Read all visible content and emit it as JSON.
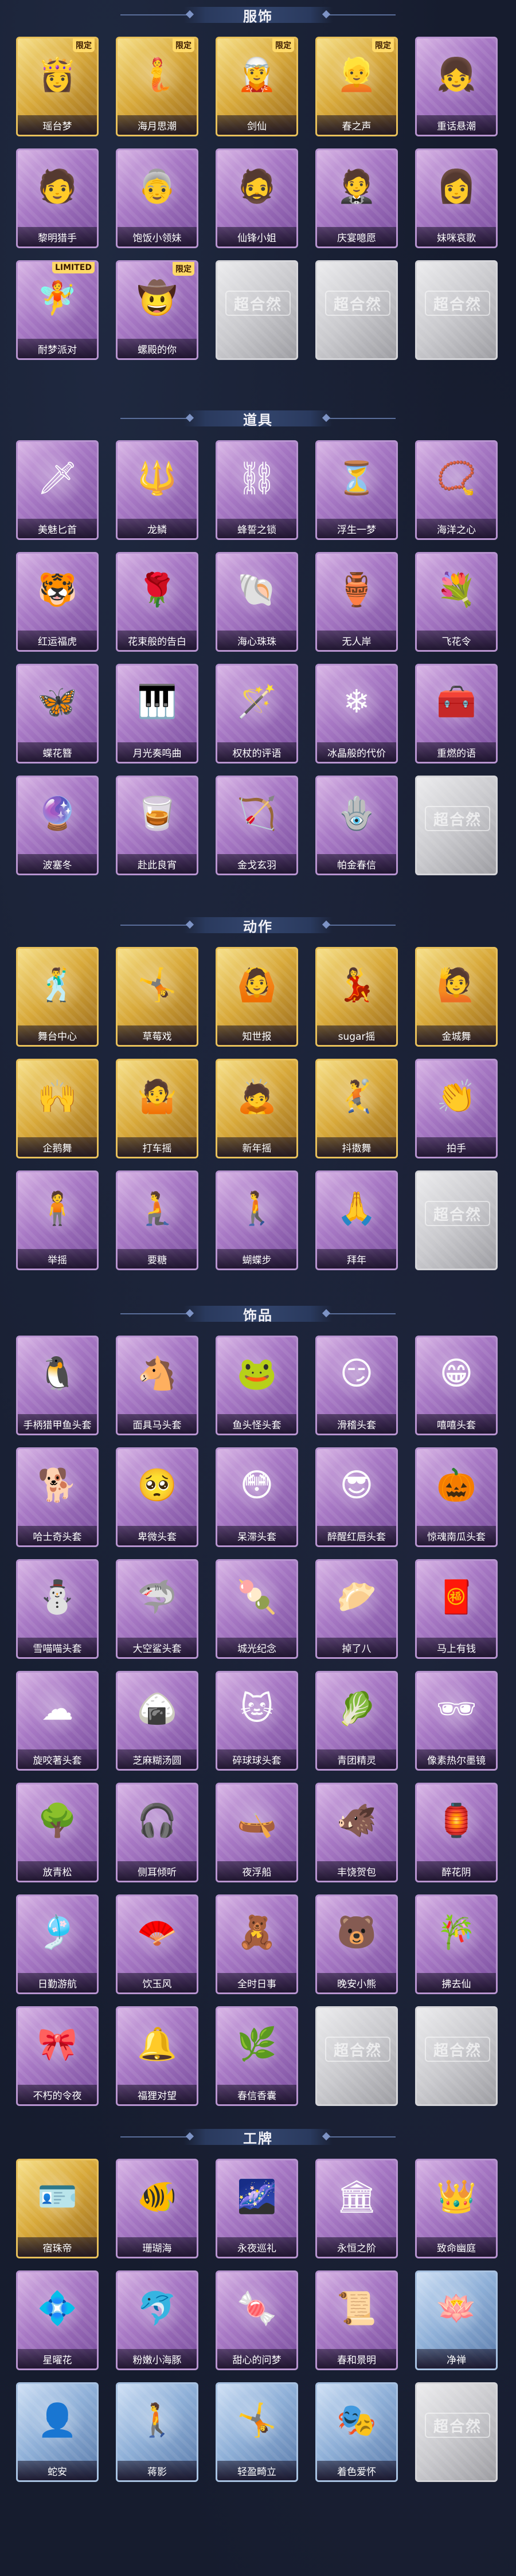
{
  "sections": [
    {
      "title": "服饰",
      "items": [
        {
          "label": "瑶台梦",
          "style": "gold",
          "tag": "限定",
          "icon": "👸"
        },
        {
          "label": "海月思潮",
          "style": "gold",
          "tag": "限定",
          "icon": "🧜"
        },
        {
          "label": "剑仙",
          "style": "gold",
          "tag": "限定",
          "icon": "🧝"
        },
        {
          "label": "春之声",
          "style": "gold",
          "tag": "限定",
          "icon": "👱"
        },
        {
          "label": "重话悬潮",
          "style": "purple",
          "tag": "",
          "icon": "👧"
        },
        {
          "label": "黎明猎手",
          "style": "purple",
          "tag": "",
          "icon": "🧑"
        },
        {
          "label": "饱饭小领妹",
          "style": "purple",
          "tag": "",
          "icon": "👵"
        },
        {
          "label": "仙锋小姐",
          "style": "purple",
          "tag": "",
          "icon": "🧔"
        },
        {
          "label": "庆宴噫愿",
          "style": "purple",
          "tag": "",
          "icon": "🤵"
        },
        {
          "label": "妹咪哀歌",
          "style": "purple",
          "tag": "",
          "icon": "👩"
        },
        {
          "label": "耐梦派对",
          "style": "purple",
          "tag": "LIMITED",
          "icon": "🧚"
        },
        {
          "label": "螺殿的你",
          "style": "purple",
          "tag": "限定",
          "icon": "🤠"
        },
        {
          "label": "",
          "style": "grey",
          "tag": "",
          "icon": ""
        },
        {
          "label": "",
          "style": "grey",
          "tag": "",
          "icon": ""
        },
        {
          "label": "",
          "style": "grey",
          "tag": "",
          "icon": ""
        }
      ]
    },
    {
      "title": "道具",
      "items": [
        {
          "label": "美魅匕首",
          "style": "purple",
          "tag": "",
          "icon": "🗡"
        },
        {
          "label": "龙鳞",
          "style": "purple",
          "tag": "",
          "icon": "🔱"
        },
        {
          "label": "蜂誓之锁",
          "style": "purple",
          "tag": "",
          "icon": "⛓"
        },
        {
          "label": "浮生一梦",
          "style": "purple",
          "tag": "",
          "icon": "⏳"
        },
        {
          "label": "海洋之心",
          "style": "purple",
          "tag": "",
          "icon": "📿"
        },
        {
          "label": "红运福虎",
          "style": "purple",
          "tag": "",
          "icon": "🐯"
        },
        {
          "label": "花束般的告白",
          "style": "purple",
          "tag": "",
          "icon": "🌹"
        },
        {
          "label": "海心珠珠",
          "style": "purple",
          "tag": "",
          "icon": "🐚"
        },
        {
          "label": "无人岸",
          "style": "purple",
          "tag": "",
          "icon": "🏺"
        },
        {
          "label": "飞花令",
          "style": "purple",
          "tag": "",
          "icon": "💐"
        },
        {
          "label": "蝶花簪",
          "style": "purple",
          "tag": "",
          "icon": "🦋"
        },
        {
          "label": "月光奏鸣曲",
          "style": "purple",
          "tag": "",
          "icon": "🎹"
        },
        {
          "label": "权杖的评语",
          "style": "purple",
          "tag": "",
          "icon": "🪄"
        },
        {
          "label": "冰晶般的代价",
          "style": "purple",
          "tag": "",
          "icon": "❄"
        },
        {
          "label": "重燃的语",
          "style": "purple",
          "tag": "",
          "icon": "🧰"
        },
        {
          "label": "波塞冬",
          "style": "purple",
          "tag": "",
          "icon": "🔮"
        },
        {
          "label": "赴此良宵",
          "style": "purple",
          "tag": "",
          "icon": "🥃"
        },
        {
          "label": "金戈玄羽",
          "style": "purple",
          "tag": "",
          "icon": "🏹"
        },
        {
          "label": "帕金春信",
          "style": "purple",
          "tag": "",
          "icon": "🪬"
        },
        {
          "label": "",
          "style": "grey",
          "tag": "",
          "icon": ""
        }
      ]
    },
    {
      "title": "动作",
      "items": [
        {
          "label": "舞台中心",
          "style": "gold",
          "tag": "",
          "icon": "🕺"
        },
        {
          "label": "草莓戏",
          "style": "gold",
          "tag": "",
          "icon": "🤸"
        },
        {
          "label": "知世报",
          "style": "gold",
          "tag": "",
          "icon": "🙆"
        },
        {
          "label": "sugar摇",
          "style": "gold",
          "tag": "",
          "icon": "💃"
        },
        {
          "label": "金城舞",
          "style": "gold",
          "tag": "",
          "icon": "🙋"
        },
        {
          "label": "企鹅舞",
          "style": "gold",
          "tag": "",
          "icon": "🙌"
        },
        {
          "label": "打车摇",
          "style": "gold",
          "tag": "",
          "icon": "🤷"
        },
        {
          "label": "新年摇",
          "style": "gold",
          "tag": "",
          "icon": "🙇"
        },
        {
          "label": "抖擞舞",
          "style": "gold",
          "tag": "",
          "icon": "🤾"
        },
        {
          "label": "拍手",
          "style": "purple",
          "tag": "",
          "icon": "👏"
        },
        {
          "label": "举摇",
          "style": "purple",
          "tag": "",
          "icon": "🧍"
        },
        {
          "label": "要糖",
          "style": "purple",
          "tag": "",
          "icon": "🧎"
        },
        {
          "label": "蝴蝶步",
          "style": "purple",
          "tag": "",
          "icon": "🚶"
        },
        {
          "label": "拜年",
          "style": "purple",
          "tag": "",
          "icon": "🙏"
        },
        {
          "label": "",
          "style": "grey",
          "tag": "",
          "icon": ""
        }
      ]
    },
    {
      "title": "饰品",
      "items": [
        {
          "label": "手柄猎甲鱼头套",
          "style": "purple",
          "tag": "",
          "icon": "🐧"
        },
        {
          "label": "面具马头套",
          "style": "purple",
          "tag": "",
          "icon": "🐴"
        },
        {
          "label": "鱼头怪头套",
          "style": "purple",
          "tag": "",
          "icon": "🐸"
        },
        {
          "label": "滑稽头套",
          "style": "purple",
          "tag": "",
          "icon": "😏"
        },
        {
          "label": "嘻嘻头套",
          "style": "purple",
          "tag": "",
          "icon": "😁"
        },
        {
          "label": "哈士奇头套",
          "style": "purple",
          "tag": "",
          "icon": "🐕"
        },
        {
          "label": "卑微头套",
          "style": "purple",
          "tag": "",
          "icon": "🥺"
        },
        {
          "label": "呆滞头套",
          "style": "purple",
          "tag": "",
          "icon": "😳"
        },
        {
          "label": "醉醒红唇头套",
          "style": "purple",
          "tag": "",
          "icon": "😎"
        },
        {
          "label": "惊魂南瓜头套",
          "style": "purple",
          "tag": "",
          "icon": "🎃"
        },
        {
          "label": "雪喵喵头套",
          "style": "purple",
          "tag": "",
          "icon": "⛄"
        },
        {
          "label": "大空鲨头套",
          "style": "purple",
          "tag": "",
          "icon": "🦈"
        },
        {
          "label": "城光纪念",
          "style": "purple",
          "tag": "",
          "icon": "🍡"
        },
        {
          "label": "掉了八",
          "style": "purple",
          "tag": "",
          "icon": "🥟"
        },
        {
          "label": "马上有钱",
          "style": "purple",
          "tag": "",
          "icon": "🧧"
        },
        {
          "label": "旋咬著头套",
          "style": "purple",
          "tag": "",
          "icon": "☁"
        },
        {
          "label": "芝麻糊汤圆",
          "style": "purple",
          "tag": "",
          "icon": "🍙"
        },
        {
          "label": "碎球球头套",
          "style": "purple",
          "tag": "",
          "icon": "🐱"
        },
        {
          "label": "青团精灵",
          "style": "purple",
          "tag": "",
          "icon": "🥬"
        },
        {
          "label": "像素热尔墨镜",
          "style": "purple",
          "tag": "",
          "icon": "🕶"
        },
        {
          "label": "放青松",
          "style": "purple",
          "tag": "",
          "icon": "🌳"
        },
        {
          "label": "侧耳倾听",
          "style": "purple",
          "tag": "",
          "icon": "🎧"
        },
        {
          "label": "夜浮船",
          "style": "purple",
          "tag": "",
          "icon": "🛶"
        },
        {
          "label": "丰饶贺包",
          "style": "purple",
          "tag": "",
          "icon": "🐗"
        },
        {
          "label": "醉花阴",
          "style": "purple",
          "tag": "",
          "icon": "🏮"
        },
        {
          "label": "日勤游航",
          "style": "purple",
          "tag": "",
          "icon": "🎐"
        },
        {
          "label": "饮玉风",
          "style": "purple",
          "tag": "",
          "icon": "🪭"
        },
        {
          "label": "全时日事",
          "style": "purple",
          "tag": "",
          "icon": "🧸"
        },
        {
          "label": "晚安小熊",
          "style": "purple",
          "tag": "",
          "icon": "🐻"
        },
        {
          "label": "拂去仙",
          "style": "purple",
          "tag": "",
          "icon": "🎋"
        },
        {
          "label": "不朽的令夜",
          "style": "purple",
          "tag": "",
          "icon": "🎀"
        },
        {
          "label": "福狸对望",
          "style": "purple",
          "tag": "",
          "icon": "🔔"
        },
        {
          "label": "春信香囊",
          "style": "purple",
          "tag": "",
          "icon": "🌿"
        },
        {
          "label": "",
          "style": "grey",
          "tag": "",
          "icon": ""
        },
        {
          "label": "",
          "style": "grey",
          "tag": "",
          "icon": ""
        }
      ]
    },
    {
      "title": "工牌",
      "items": [
        {
          "label": "宿珠帝",
          "style": "gold",
          "tag": "",
          "icon": "🪪"
        },
        {
          "label": "珊瑚海",
          "style": "purple",
          "tag": "",
          "icon": "🐠"
        },
        {
          "label": "永夜巡礼",
          "style": "purple",
          "tag": "",
          "icon": "🌌"
        },
        {
          "label": "永恒之阶",
          "style": "purple",
          "tag": "",
          "icon": "🏛"
        },
        {
          "label": "致命幽庭",
          "style": "purple",
          "tag": "",
          "icon": "👑"
        },
        {
          "label": "星曜花",
          "style": "purple",
          "tag": "",
          "icon": "💠"
        },
        {
          "label": "粉嫩小海豚",
          "style": "purple",
          "tag": "",
          "icon": "🐬"
        },
        {
          "label": "甜心的问梦",
          "style": "purple",
          "tag": "",
          "icon": "🍬"
        },
        {
          "label": "春和景明",
          "style": "purple",
          "tag": "",
          "icon": "📜"
        },
        {
          "label": "净禅",
          "style": "blue",
          "tag": "",
          "icon": "🪷"
        },
        {
          "label": "蛇安",
          "style": "blue",
          "tag": "",
          "icon": "👤"
        },
        {
          "label": "蒋影",
          "style": "blue",
          "tag": "",
          "icon": "🚶"
        },
        {
          "label": "轻盈畸立",
          "style": "blue",
          "tag": "",
          "icon": "🤸"
        },
        {
          "label": "着色爱怀",
          "style": "blue",
          "tag": "",
          "icon": "🎭"
        },
        {
          "label": "",
          "style": "grey",
          "tag": "",
          "icon": ""
        }
      ]
    }
  ],
  "empty_logo_text": "超合然"
}
